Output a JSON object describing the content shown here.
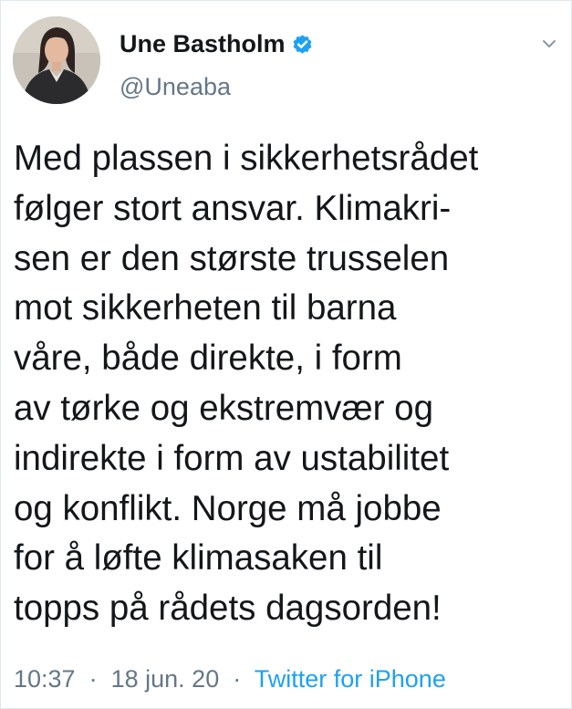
{
  "author": {
    "display_name": "Une Bastholm",
    "handle": "@Uneaba",
    "verified": true
  },
  "tweet": {
    "lines": [
      "Med plassen i sikkerhetsrådet",
      "følger stort ansvar. Klimakri-",
      "sen er den største trusselen",
      "mot sikkerheten til barna",
      "våre, både direkte, i form",
      "av tørke og ekstremvær og",
      "indirekte i form av ustabilitet",
      "og konflikt. Norge må jobbe",
      "for å løfte klimasaken til",
      "topps på rådets dagsorden!"
    ]
  },
  "meta": {
    "time": "10:37",
    "separator": "·",
    "date": "18 jun. 20",
    "source": "Twitter for iPhone"
  },
  "icons": {
    "verified": "verified-badge-icon",
    "menu": "chevron-down-icon"
  },
  "colors": {
    "text": "#14171a",
    "secondary": "#657786",
    "accent": "#1da1f2",
    "border": "#e1e8ed"
  }
}
